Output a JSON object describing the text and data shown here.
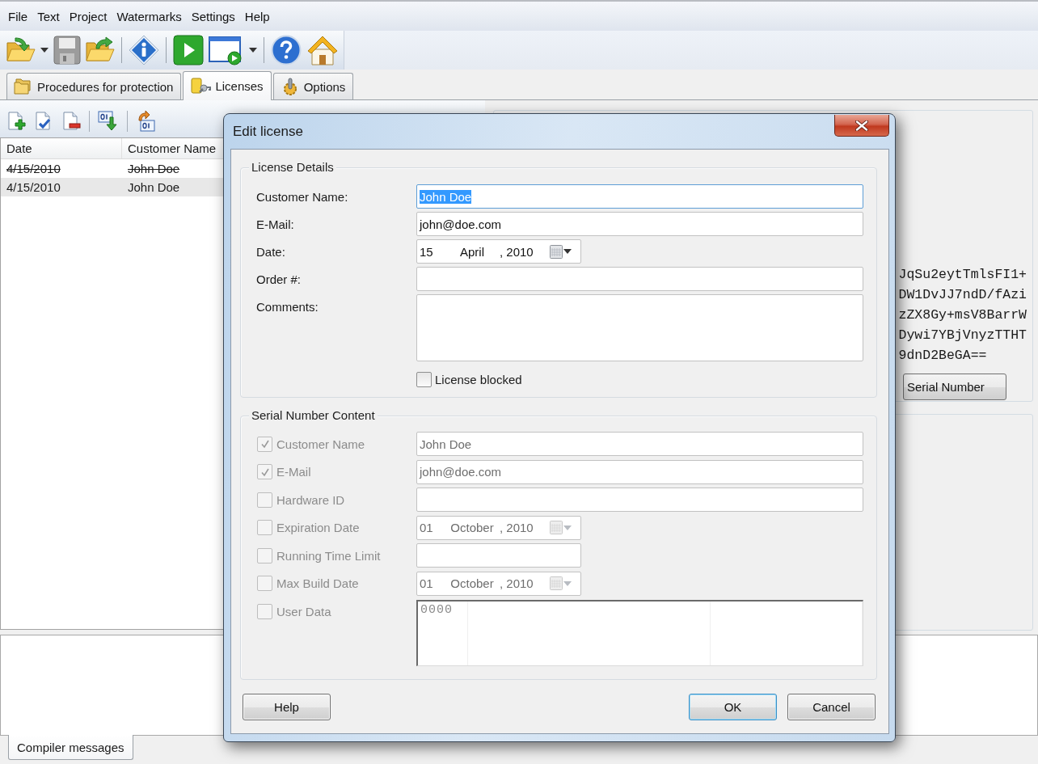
{
  "menu": [
    "File",
    "Text",
    "Project",
    "Watermarks",
    "Settings",
    "Help"
  ],
  "tabs": [
    {
      "label": "Procedures for protection",
      "selected": false
    },
    {
      "label": "Licenses",
      "selected": true
    },
    {
      "label": "Options",
      "selected": false
    }
  ],
  "license_list": {
    "columns": [
      "Date",
      "Customer Name"
    ],
    "rows": [
      {
        "cells": [
          "4/15/2010",
          "John Doe"
        ],
        "blocked": true,
        "selected": false
      },
      {
        "cells": [
          "4/15/2010",
          "John Doe"
        ],
        "blocked": false,
        "selected": true
      }
    ]
  },
  "serial_number": {
    "lines": [
      "JqSu2eytTmlsFI1+",
      "DW1DvJJ7ndD/fAzi",
      "zZX8Gy+msV8BarrW",
      "Dywi7YBjVnyzTTHT",
      "9dnD2BeGA=="
    ],
    "button": "Serial Number"
  },
  "bottom_tabs": [
    {
      "label": "Compiler messages",
      "selected": true
    }
  ],
  "dialog": {
    "title": "Edit license",
    "license_details": {
      "title": "License Details",
      "fields": [
        {
          "kind": "text",
          "label": "Customer Name:",
          "value": "John Doe",
          "value_selected": true
        },
        {
          "kind": "text",
          "label": "E-Mail:",
          "value": "john@doe.com",
          "value_selected": false
        },
        {
          "kind": "date",
          "label": "Date:",
          "day": "15",
          "month": "April",
          "year": ", 2010"
        },
        {
          "kind": "text",
          "label": "Order #:"
        },
        {
          "kind": "textarea",
          "label": "Comments:"
        },
        {
          "kind": "checkbox",
          "label": "License blocked",
          "checked": false
        }
      ]
    },
    "serial_content": {
      "title": "Serial Number Content",
      "rows": [
        {
          "kind": "text",
          "label": "Customer Name",
          "checked": true,
          "disabled": true,
          "value": "John Doe"
        },
        {
          "kind": "text",
          "label": "E-Mail",
          "checked": true,
          "disabled": true,
          "value": "john@doe.com"
        },
        {
          "kind": "text",
          "label": "Hardware ID",
          "checked": false,
          "disabled": true
        },
        {
          "kind": "date",
          "label": "Expiration Date",
          "checked": false,
          "disabled": true,
          "day": "01",
          "month": "October",
          "year": ", 2010"
        },
        {
          "kind": "short_text",
          "label": "Running Time Limit",
          "checked": false,
          "disabled": true
        },
        {
          "kind": "date",
          "label": "Max Build Date",
          "checked": false,
          "disabled": true,
          "day": "01",
          "month": "October",
          "year": ", 2010"
        },
        {
          "kind": "hex",
          "label": "User Data",
          "checked": false,
          "disabled": true,
          "value": "0000"
        }
      ]
    },
    "help_button": "Help",
    "buttons": [
      {
        "label": "OK",
        "default": true
      },
      {
        "label": "Cancel",
        "default": false
      }
    ]
  }
}
